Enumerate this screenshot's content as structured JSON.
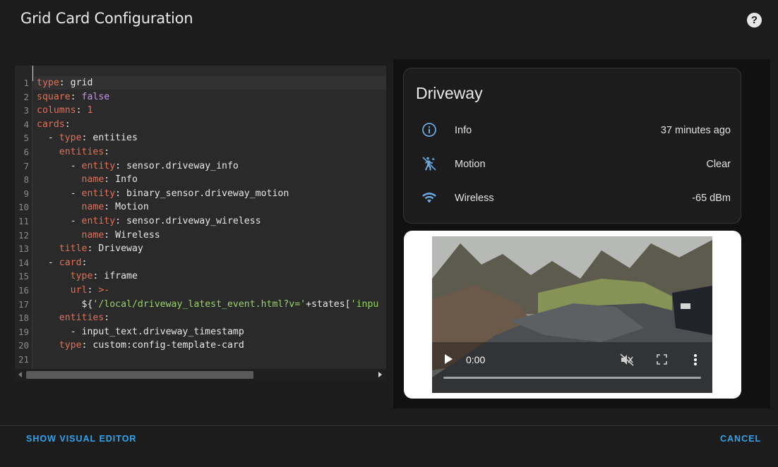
{
  "dialog": {
    "title": "Grid Card Configuration",
    "help_icon_char": "?"
  },
  "editor": {
    "lines": [
      {
        "n": "1",
        "html": "<span class='k'>type</span>: grid"
      },
      {
        "n": "2",
        "html": "<span class='k'>square</span>: <span class='b'>false</span>"
      },
      {
        "n": "3",
        "html": "<span class='k'>columns</span>: <span class='n'>1</span>"
      },
      {
        "n": "4",
        "html": "<span class='k'>cards</span>:"
      },
      {
        "n": "5",
        "html": "  - <span class='k'>type</span>: entities"
      },
      {
        "n": "6",
        "html": "    <span class='k'>entities</span>:"
      },
      {
        "n": "7",
        "html": "      - <span class='k'>entity</span>: sensor.driveway_info"
      },
      {
        "n": "8",
        "html": "        <span class='k'>name</span>: Info"
      },
      {
        "n": "9",
        "html": "      - <span class='k'>entity</span>: binary_sensor.driveway_motion"
      },
      {
        "n": "10",
        "html": "        <span class='k'>name</span>: Motion"
      },
      {
        "n": "11",
        "html": "      - <span class='k'>entity</span>: sensor.driveway_wireless"
      },
      {
        "n": "12",
        "html": "        <span class='k'>name</span>: Wireless"
      },
      {
        "n": "13",
        "html": "    <span class='k'>title</span>: Driveway"
      },
      {
        "n": "14",
        "html": "  - <span class='k'>card</span>:"
      },
      {
        "n": "15",
        "html": "      <span class='k'>type</span>: iframe"
      },
      {
        "n": "16",
        "html": "      <span class='k'>url</span>: <span class='k'>&gt;-</span>"
      },
      {
        "n": "17",
        "html": "        ${<span class='s'>'/local/driveway_latest_event.html?v='</span>+states[<span class='s'>'inpu</span>"
      },
      {
        "n": "18",
        "html": "    <span class='k'>entities</span>:"
      },
      {
        "n": "19",
        "html": "      - input_text.driveway_timestamp"
      },
      {
        "n": "20",
        "html": "    <span class='k'>type</span>: custom:config-template-card"
      },
      {
        "n": "21",
        "html": ""
      }
    ]
  },
  "entities_card": {
    "title": "Driveway",
    "rows": [
      {
        "icon": "info-icon",
        "label": "Info",
        "value": "37 minutes ago"
      },
      {
        "icon": "walk-icon",
        "label": "Motion",
        "value": "Clear"
      },
      {
        "icon": "wifi-icon",
        "label": "Wireless",
        "value": "-65 dBm"
      }
    ]
  },
  "video": {
    "time": "0:00"
  },
  "footer": {
    "left_button": "SHOW VISUAL EDITOR",
    "right_button": "CANCEL"
  },
  "colors": {
    "accent": "#2fa4f0",
    "key": "#e66e55",
    "bool": "#c792ea",
    "string": "#9bd06a",
    "icon": "#6aa8e0"
  }
}
